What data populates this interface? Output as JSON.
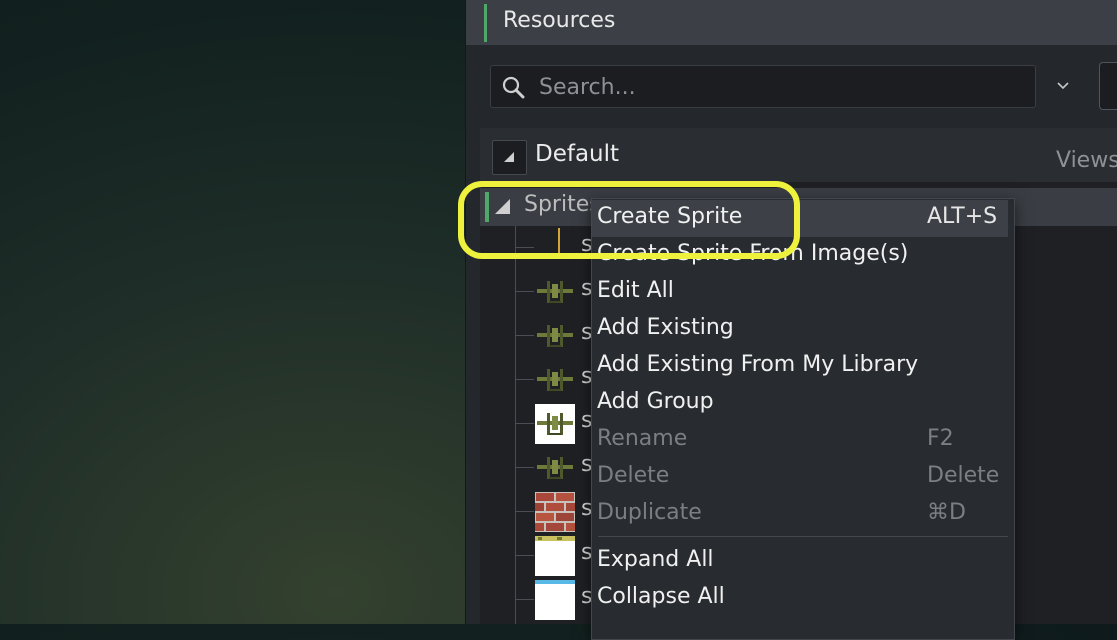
{
  "resources": {
    "title": "Resources",
    "search_placeholder": "Search...",
    "default_group": "Default",
    "views_label": "Views"
  },
  "tree": {
    "group_label": "Sprites",
    "items": [
      {
        "label": "sp",
        "thumb": "plane-partial"
      },
      {
        "label": "sp",
        "thumb": "plane"
      },
      {
        "label": "sp",
        "thumb": "plane"
      },
      {
        "label": "sp",
        "thumb": "plane"
      },
      {
        "label": "sp",
        "thumb": "plane-white-bg"
      },
      {
        "label": "sp",
        "thumb": "plane"
      },
      {
        "label": "sp",
        "thumb": "brick"
      },
      {
        "label": "sp",
        "thumb": "white-tile-yellow"
      },
      {
        "label": "sp",
        "thumb": "white-tile-blue"
      }
    ]
  },
  "context_menu": {
    "items": [
      {
        "label": "Create Sprite",
        "shortcut": "ALT+S",
        "enabled": true
      },
      {
        "label": "Create Sprite From Image(s)",
        "shortcut": "",
        "enabled": true
      },
      {
        "label": "Edit All",
        "shortcut": "",
        "enabled": true
      },
      {
        "label": "Add Existing",
        "shortcut": "",
        "enabled": true
      },
      {
        "label": "Add Existing From My Library",
        "shortcut": "",
        "enabled": true
      },
      {
        "label": "Add Group",
        "shortcut": "",
        "enabled": true
      },
      {
        "label": "Rename",
        "shortcut": "F2",
        "enabled": false
      },
      {
        "label": "Delete",
        "shortcut": "Delete",
        "enabled": false
      },
      {
        "label": "Duplicate",
        "shortcut": "⌘D",
        "enabled": false
      },
      {
        "label": "Expand All",
        "shortcut": "",
        "enabled": true
      },
      {
        "label": "Collapse All",
        "shortcut": "",
        "enabled": true
      }
    ]
  },
  "colors": {
    "accent_green": "#4fa86a",
    "highlight_yellow": "#eef23c",
    "panel_bg": "#24272b"
  }
}
